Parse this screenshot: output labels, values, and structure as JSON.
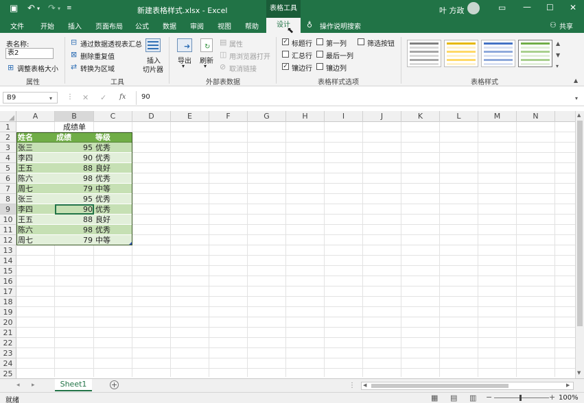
{
  "titlebar": {
    "filename": "新建表格样式.xlsx - Excel",
    "context_group": "表格工具",
    "user": "叶 方政"
  },
  "tabs": [
    "文件",
    "开始",
    "插入",
    "页面布局",
    "公式",
    "数据",
    "审阅",
    "视图",
    "帮助"
  ],
  "active_tab": "设计",
  "tell_me": "操作说明搜索",
  "share": "共享",
  "ribbon": {
    "properties": {
      "name_label": "表名称:",
      "name_value": "表2",
      "resize": "调整表格大小",
      "group": "属性"
    },
    "tools": {
      "pivot": "通过数据透视表汇总",
      "remove_dup": "删除重复值",
      "convert": "转换为区域",
      "slicer_line1": "插入",
      "slicer_line2": "切片器",
      "group": "工具"
    },
    "external": {
      "export": "导出",
      "refresh": "刷新",
      "props": "属性",
      "open_browser": "用浏览器打开",
      "unlink": "取消链接",
      "group": "外部表数据"
    },
    "options": {
      "header_row": "标题行",
      "first_col": "第一列",
      "filter_btn": "筛选按钮",
      "total_row": "汇总行",
      "last_col": "最后一列",
      "banded_rows": "镶边行",
      "banded_cols": "镶边列",
      "group": "表格样式选项"
    },
    "styles": {
      "group": "表格样式"
    }
  },
  "formula_bar": {
    "name_box": "B9",
    "fx": "fx",
    "value": "90"
  },
  "columns": [
    "A",
    "B",
    "C",
    "D",
    "E",
    "F",
    "G",
    "H",
    "I",
    "J",
    "K",
    "L",
    "M",
    "N"
  ],
  "rows": [
    "1",
    "2",
    "3",
    "4",
    "5",
    "6",
    "7",
    "8",
    "9",
    "10",
    "11",
    "12",
    "13",
    "14",
    "15",
    "16",
    "17",
    "18",
    "19",
    "20",
    "21",
    "22",
    "23",
    "24",
    "25"
  ],
  "table": {
    "title": "成绩单",
    "headers": [
      "姓名",
      "成绩",
      "等级"
    ],
    "data": [
      [
        "张三",
        "95",
        "优秀"
      ],
      [
        "李四",
        "90",
        "优秀"
      ],
      [
        "王五",
        "88",
        "良好"
      ],
      [
        "陈六",
        "98",
        "优秀"
      ],
      [
        "周七",
        "79",
        "中等"
      ],
      [
        "张三",
        "95",
        "优秀"
      ],
      [
        "李四",
        "90",
        "优秀"
      ],
      [
        "王五",
        "88",
        "良好"
      ],
      [
        "陈六",
        "98",
        "优秀"
      ],
      [
        "周七",
        "79",
        "中等"
      ]
    ]
  },
  "sheets": [
    "Sheet1"
  ],
  "status": {
    "ready": "就绪",
    "zoom": "100%"
  },
  "colors": {
    "brand": "#217346",
    "header_fill": "#70ad47",
    "band_light": "#e2efda",
    "band_mid": "#c6e0b4"
  }
}
